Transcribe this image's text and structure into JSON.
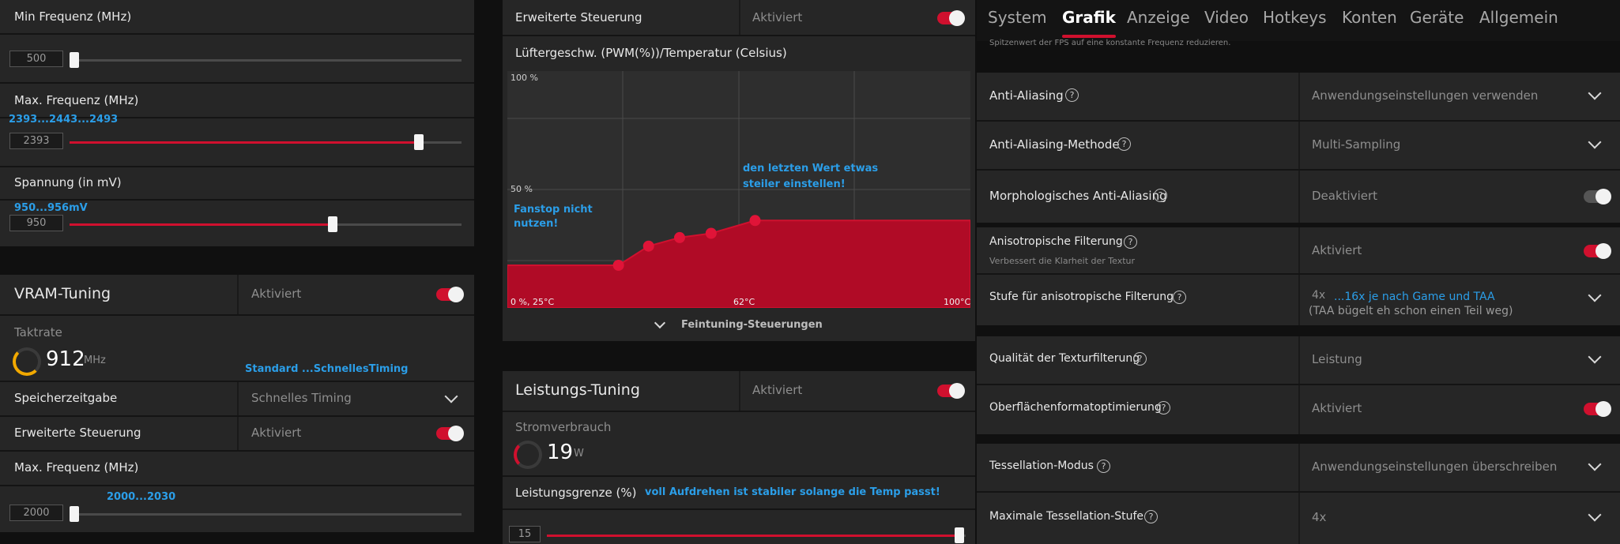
{
  "left": {
    "min_freq": {
      "label": "Min Frequenz (MHz)",
      "value": "500",
      "fraction": 0.0
    },
    "max_freq": {
      "label": "Max. Frequenz (MHz)",
      "value": "2393",
      "note": "2393...2443...2493",
      "fraction": 0.89
    },
    "voltage": {
      "label": "Spannung (in mV)",
      "value": "950",
      "note": "950...956mV",
      "fraction": 0.67
    },
    "vram": {
      "title": "VRAM-Tuning",
      "status": "Aktiviert",
      "clock_label": "Taktrate",
      "clock_value": "912",
      "clock_unit": "MHz",
      "timing_note": "Standard ...SchnellesTiming",
      "timing_label": "Speicherzeitgabe",
      "timing_value": "Schnelles Timing",
      "advanced_label": "Erweiterte Steuerung",
      "advanced_value": "Aktiviert",
      "max_freq_label": "Max. Frequenz (MHz)",
      "max_freq_value": "2000",
      "max_freq_note": "2000...2030",
      "max_freq_fraction": 0.0
    }
  },
  "middle": {
    "fan": {
      "advanced_label": "Erweiterte Steuerung",
      "advanced_value": "Aktiviert",
      "curve_title": "Lüftergeschw. (PWM(%))/Temperatur (Celsius)",
      "y_top": "100 %",
      "y_mid": "50 %",
      "x_left": "0 %, 25°C",
      "x_mid": "62°C",
      "x_right": "100°C",
      "note_fanstop_1": "Fanstop nicht",
      "note_fanstop_2": "nutzen!",
      "note_last_1": "den letzten Wert etwas",
      "note_last_2": "steiler einstellen!",
      "fine_tuning": "Feintuning-Steuerungen",
      "curve_points": [
        {
          "temp_frac": 0.24,
          "pwm": 20
        },
        {
          "temp_frac": 0.305,
          "pwm": 29
        },
        {
          "temp_frac": 0.372,
          "pwm": 33
        },
        {
          "temp_frac": 0.44,
          "pwm": 35
        },
        {
          "temp_frac": 0.535,
          "pwm": 41
        }
      ]
    },
    "power": {
      "title": "Leistungs-Tuning",
      "status": "Aktiviert",
      "consumption_label": "Stromverbrauch",
      "consumption_value": "19",
      "consumption_unit": "W",
      "limit_label": "Leistungsgrenze (%)",
      "limit_note": "voll Aufdrehen ist stabiler solange die Temp passt!",
      "limit_value": "15",
      "limit_fraction": 1.0
    }
  },
  "right": {
    "tabs": [
      "System",
      "Grafik",
      "Anzeige",
      "Video",
      "Hotkeys",
      "Konten",
      "Geräte",
      "Allgemein"
    ],
    "active_tab": "Grafik",
    "cut_text": "Spitzenwert der FPS auf eine konstante Frequenz reduzieren.",
    "settings": {
      "aa": {
        "label": "Anti-Aliasing",
        "value": "Anwendungseinstellungen verwenden"
      },
      "aa_method": {
        "label": "Anti-Aliasing-Methode",
        "value": "Multi-Sampling"
      },
      "morph": {
        "label": "Morphologisches Anti-Aliasing",
        "value": "Deaktiviert"
      },
      "aniso": {
        "label": "Anisotropische Filterung",
        "sub": "Verbessert die Klarheit der Textur",
        "value": "Aktiviert"
      },
      "aniso_level": {
        "label": "Stufe für anisotropische Filterung",
        "value": "4x",
        "note": "...16x je nach Game und TAA",
        "note2": "(TAA bügelt eh schon einen Teil weg)"
      },
      "tex_quality": {
        "label": "Qualität der Texturfilterung",
        "value": "Leistung"
      },
      "surface": {
        "label": "Oberflächenformatoptimierung",
        "value": "Aktiviert"
      },
      "tess_mode": {
        "label": "Tessellation-Modus",
        "value": "Anwendungseinstellungen überschreiben"
      },
      "tess_max": {
        "label": "Maximale Tessellation-Stufe",
        "value": "4x"
      }
    },
    "help_glyph": "?"
  },
  "colors": {
    "accent": "#d0102e",
    "note": "#2b9ee8",
    "panel": "#262626",
    "chart_bg": "#2e2e2e"
  }
}
